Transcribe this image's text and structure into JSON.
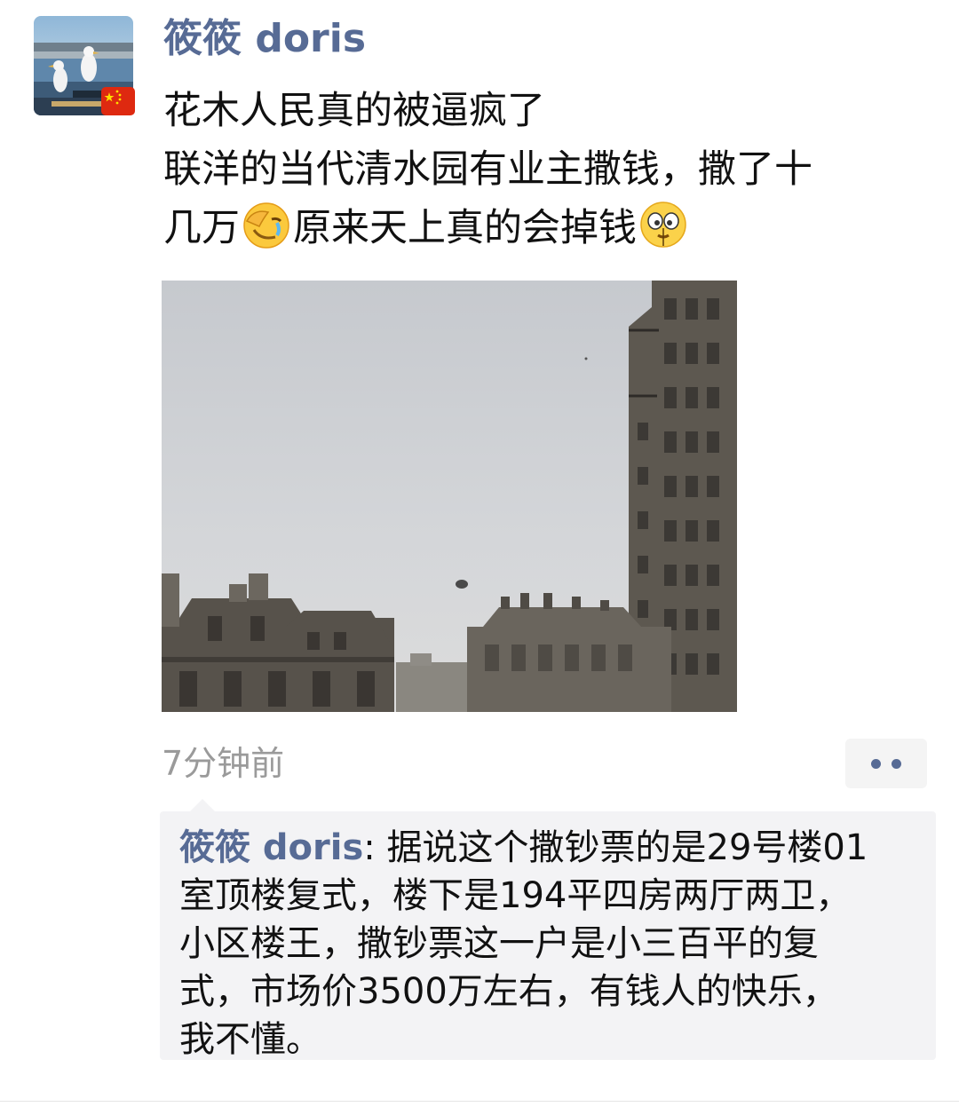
{
  "post": {
    "author": "筱筱 doris",
    "text_lines": [
      "花木人民真的被逼疯了",
      "联洋的当代清水园有业主撒钱，撒了十",
      "几万",
      "原来天上真的会掉钱"
    ],
    "timestamp": "7分钟前"
  },
  "icons": {
    "emoji_1": "facepalm-crying-emoji",
    "emoji_2": "dizzy-money-face-emoji",
    "more": "more-dots-icon",
    "flag": "china-flag-icon"
  },
  "comment": {
    "author": "筱筱 doris",
    "separator": ": ",
    "text_lines": [
      "据说这个撒钞票的是29号楼01",
      "室顶楼复式，楼下是194平四房两厅两卫，",
      "小区楼王，撒钞票这一户是小三百平的复",
      "式，市场价3500万左右，有钱人的快乐，",
      "我不懂。"
    ]
  },
  "colors": {
    "name_link": "#576b95",
    "timestamp": "#9a9a9a",
    "comment_bg": "#f3f3f5",
    "text": "#111111"
  }
}
